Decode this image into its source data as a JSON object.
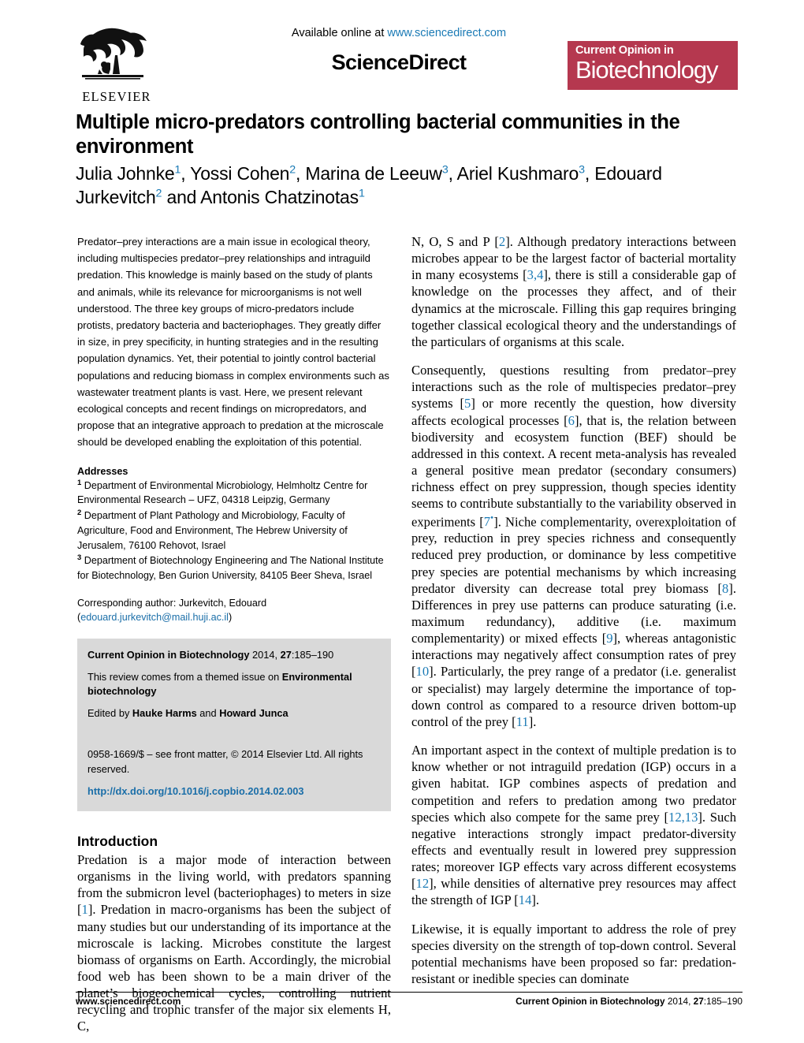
{
  "header": {
    "publisher_logo_name": "ELSEVIER",
    "available_online_prefix": "Available online at ",
    "available_online_url": "www.sciencedirect.com",
    "sciencedirect_wordmark": "ScienceDirect",
    "journal_logo_top": "Current Opinion in",
    "journal_logo_bottom": "Biotechnology",
    "journal_logo_color": "#b5384f",
    "link_color": "#1a7ab5"
  },
  "article": {
    "title": "Multiple micro-predators controlling bacterial communities in the environment",
    "authors_line_1": "Julia Johnke",
    "authors_sup_1": "1",
    "authors_line_1b": ", Yossi Cohen",
    "authors_sup_2": "2",
    "authors_line_1c": ", Marina de Leeuw",
    "authors_sup_3": "3",
    "authors_line_1d": ", Ariel Kushmaro",
    "authors_sup_4": "3",
    "authors_line_1e": ",",
    "authors_line_2a": "Edouard Jurkevitch",
    "authors_sup_5": "2",
    "authors_line_2b": " and Antonis Chatzinotas",
    "authors_sup_6": "1"
  },
  "abstract": {
    "text": "Predator–prey interactions are a main issue in ecological theory, including multispecies predator–prey relationships and intraguild predation. This knowledge is mainly based on the study of plants and animals, while its relevance for microorganisms is not well understood. The three key groups of micro-predators include protists, predatory bacteria and bacteriophages. They greatly differ in size, in prey specificity, in hunting strategies and in the resulting population dynamics. Yet, their potential to jointly control bacterial populations and reducing biomass in complex environments such as wastewater treatment plants is vast. Here, we present relevant ecological concepts and recent findings on micropredators, and propose that an integrative approach to predation at the microscale should be developed enabling the exploitation of this potential."
  },
  "addresses": {
    "heading": "Addresses",
    "items": [
      {
        "sup": "1",
        "text": " Department of Environmental Microbiology, Helmholtz Centre for Environmental Research – UFZ, 04318 Leipzig, Germany"
      },
      {
        "sup": "2",
        "text": " Department of Plant Pathology and Microbiology, Faculty of Agriculture, Food and Environment, The Hebrew University of Jerusalem, 76100 Rehovot, Israel"
      },
      {
        "sup": "3",
        "text": " Department of Biotechnology Engineering and The National Institute for Biotechnology, Ben Gurion University, 84105 Beer Sheva, Israel"
      }
    ],
    "corresponding_label": "Corresponding author: Jurkevitch, Edouard",
    "corresponding_email_open": "(",
    "corresponding_email": "edouard.jurkevitch@mail.huji.ac.il",
    "corresponding_email_close": ")"
  },
  "infobox": {
    "citation_journal": "Current Opinion in Biotechnology",
    "citation_rest_a": " 2014, ",
    "citation_volume": "27",
    "citation_pages": ":185–190",
    "themed_prefix": "This review comes from a themed issue on ",
    "themed_issue": "Environmental biotechnology",
    "edited_prefix": "Edited by ",
    "editor_1": "Hauke Harms",
    "edited_and": " and ",
    "editor_2": "Howard Junca",
    "front_matter": "0958-1669/$ – see front matter, © 2014 Elsevier Ltd. All rights reserved.",
    "doi": "http://dx.doi.org/10.1016/j.copbio.2014.02.003"
  },
  "sections": {
    "introduction_heading": "Introduction"
  },
  "body": {
    "intro_p1_a": "Predation is a major mode of interaction between organisms in the living world, with predators spanning from the submicron level (bacteriophages) to meters in size [",
    "intro_p1_ref1": "1",
    "intro_p1_b": "]. Predation in macro-organisms has been the subject of many studies but our understanding of its importance at the microscale is lacking. Microbes constitute the largest biomass of organisms on Earth. Accordingly, the microbial food web has been shown to be a main driver of the planet’s biogeochemical cycles, controlling nutrient recycling and trophic transfer of the major six elements H, C,",
    "r_p1_a": "N, O, S and P [",
    "r_p1_ref1": "2",
    "r_p1_b": "]. Although predatory interactions between microbes appear to be the largest factor of bacterial mortality in many ecosystems [",
    "r_p1_ref2": "3,4",
    "r_p1_c": "], there is still a considerable gap of knowledge on the processes they affect, and of their dynamics at the microscale. Filling this gap requires bringing together classical ecological theory and the understandings of the particulars of organisms at this scale.",
    "r_p2_a": "Consequently, questions resulting from predator–prey interactions such as the role of multispecies predator–prey systems [",
    "r_p2_ref1": "5",
    "r_p2_b": "] or more recently the question, how diversity affects ecological processes [",
    "r_p2_ref2": "6",
    "r_p2_c": "], that is, the relation between biodiversity and ecosystem function (BEF) should be addressed in this context. A recent meta-analysis has revealed a general positive mean predator (secondary consumers) richness effect on prey suppression, though species identity seems to contribute substantially to the variability observed in experiments [",
    "r_p2_ref3": "7",
    "r_p2_ref3_sup": "•",
    "r_p2_d": "]. Niche complementarity, overexploitation of prey, reduction in prey species richness and consequently reduced prey production, or dominance by less competitive prey species are potential mechanisms by which increasing predator diversity can decrease total prey biomass [",
    "r_p2_ref4": "8",
    "r_p2_e": "]. Differences in prey use patterns can produce saturating (i.e. maximum redundancy), additive (i.e. maximum complementarity) or mixed effects [",
    "r_p2_ref5": "9",
    "r_p2_f": "], whereas antagonistic interactions may negatively affect consumption rates of prey [",
    "r_p2_ref6": "10",
    "r_p2_g": "]. Particularly, the prey range of a predator (i.e. generalist or specialist) may largely determine the importance of top-down control as compared to a resource driven bottom-up control of the prey [",
    "r_p2_ref7": "11",
    "r_p2_h": "].",
    "r_p3_a": "An important aspect in the context of multiple predation is to know whether or not intraguild predation (IGP) occurs in a given habitat. IGP combines aspects of predation and competition and refers to predation among two predator species which also compete for the same prey [",
    "r_p3_ref1": "12,13",
    "r_p3_b": "]. Such negative interactions strongly impact predator-diversity effects and eventually result in lowered prey suppression rates; moreover IGP effects vary across different ecosystems [",
    "r_p3_ref2": "12",
    "r_p3_c": "], while densities of alternative prey resources may affect the strength of IGP [",
    "r_p3_ref3": "14",
    "r_p3_d": "].",
    "r_p4": "Likewise, it is equally important to address the role of prey species diversity on the strength of top-down control. Several potential mechanisms have been proposed so far: predation-resistant or inedible species can dominate"
  },
  "footer": {
    "left": "www.sciencedirect.com",
    "right_journal": "Current Opinion in Biotechnology",
    "right_rest_a": " 2014, ",
    "right_volume": "27",
    "right_pages": ":185–190"
  }
}
